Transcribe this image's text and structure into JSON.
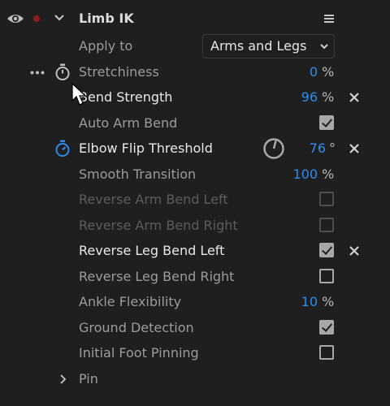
{
  "header": {
    "title": "Limb IK",
    "eye_icon": "eye-icon",
    "record_icon": "record-dot-icon",
    "collapse_icon": "chevron-down-icon",
    "menu_icon": "hamburger-menu-icon"
  },
  "apply_to": {
    "label": "Apply to",
    "selected": "Arms and Legs"
  },
  "params": {
    "stretchiness": {
      "label": "Stretchiness",
      "value": "0",
      "unit": "%"
    },
    "bend_strength": {
      "label": "Bend Strength",
      "value": "96",
      "unit": "%"
    },
    "auto_arm_bend": {
      "label": "Auto Arm Bend",
      "checked": true
    },
    "elbow_flip_threshold": {
      "label": "Elbow Flip Threshold",
      "value": "76",
      "unit": "°",
      "dial_fraction": 0.21
    },
    "smooth_transition": {
      "label": "Smooth Transition",
      "value": "100",
      "unit": "%"
    },
    "reverse_arm_bend_left": {
      "label": "Reverse Arm Bend Left",
      "checked": false,
      "disabled": true
    },
    "reverse_arm_bend_right": {
      "label": "Reverse Arm Bend Right",
      "checked": false,
      "disabled": true
    },
    "reverse_leg_bend_left": {
      "label": "Reverse Leg Bend Left",
      "checked": true
    },
    "reverse_leg_bend_right": {
      "label": "Reverse Leg Bend Right",
      "checked": false
    },
    "ankle_flexibility": {
      "label": "Ankle Flexibility",
      "value": "10",
      "unit": "%"
    },
    "ground_detection": {
      "label": "Ground Detection",
      "checked": true
    },
    "initial_foot_pinning": {
      "label": "Initial Foot Pinning",
      "checked": false
    }
  },
  "pin": {
    "label": "Pin"
  },
  "colors": {
    "accent": "#2d8ceb",
    "background": "#1f1f1f",
    "record": "#8a1e1e"
  }
}
